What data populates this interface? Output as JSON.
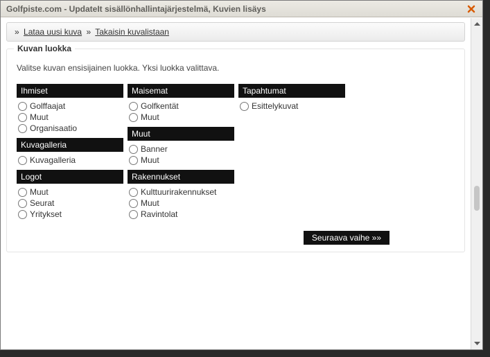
{
  "window": {
    "title": "Golfpiste.com - UpdateIt sisällönhallintajärjestelmä, Kuvien lisäys"
  },
  "breadcrumb": {
    "link1": "Lataa uusi kuva",
    "link2": "Takaisin kuvalistaan",
    "sep": "»"
  },
  "panel": {
    "title": "Kuvan luokka",
    "desc": "Valitse kuvan ensisijainen luokka. Yksi luokka valittava."
  },
  "col1": {
    "g1": {
      "title": "Ihmiset",
      "o1": "Golffaajat",
      "o2": "Muut",
      "o3": "Organisaatio"
    },
    "g2": {
      "title": "Kuvagalleria",
      "o1": "Kuvagalleria"
    },
    "g3": {
      "title": "Logot",
      "o1": "Muut",
      "o2": "Seurat",
      "o3": "Yritykset"
    }
  },
  "col2": {
    "g1": {
      "title": "Maisemat",
      "o1": "Golfkentät",
      "o2": "Muut"
    },
    "g2": {
      "title": "Muut",
      "o1": "Banner",
      "o2": "Muut"
    },
    "g3": {
      "title": "Rakennukset",
      "o1": "Kulttuurirakennukset",
      "o2": "Muut",
      "o3": "Ravintolat"
    }
  },
  "col3": {
    "g1": {
      "title": "Tapahtumat",
      "o1": "Esittelykuvat"
    }
  },
  "buttons": {
    "next": "Seuraava vaihe »»"
  }
}
